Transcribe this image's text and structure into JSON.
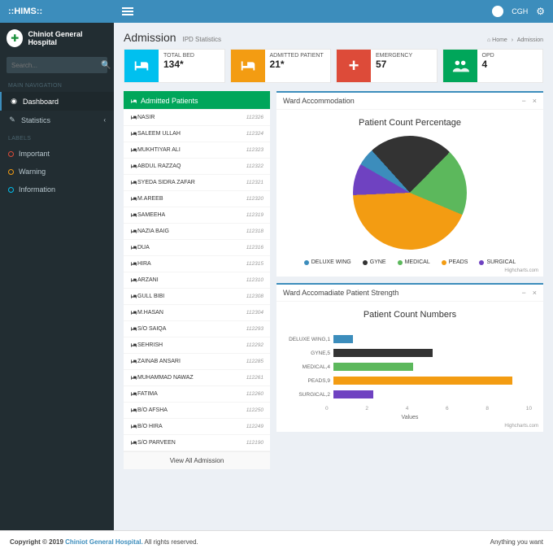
{
  "brand": "::HIMS::",
  "user_short": "CGH",
  "hospital_name": "Chiniot General Hospital",
  "search": {
    "placeholder": "Search..."
  },
  "nav": {
    "main_header": "MAIN NAVIGATION",
    "dashboard": "Dashboard",
    "statistics": "Statistics",
    "labels_header": "LABELS",
    "important": "Important",
    "warning": "Warning",
    "information": "Information"
  },
  "page": {
    "title": "Admission",
    "subtitle": "IPD Statistics",
    "breadcrumb_home": "Home",
    "breadcrumb_current": "Admission"
  },
  "stats": {
    "total_bed": {
      "label": "TOTAL BED",
      "value": "134*",
      "color": "#00c0ef"
    },
    "admitted": {
      "label": "ADMITTED PATIENT",
      "value": "21*",
      "color": "#f39c12"
    },
    "emergency": {
      "label": "EMERGENCY",
      "value": "57",
      "color": "#dd4b39"
    },
    "opd": {
      "label": "OPD",
      "value": "4",
      "color": "#00a65a"
    }
  },
  "patients": {
    "title": "Admitted Patients",
    "footer": "View All Admission",
    "list": [
      {
        "name": "NASIR",
        "id": "112326"
      },
      {
        "name": "SALEEM ULLAH",
        "id": "112324"
      },
      {
        "name": "MUKHTIYAR ALI",
        "id": "112323"
      },
      {
        "name": "ABDUL RAZZAQ",
        "id": "112322"
      },
      {
        "name": "SYEDA SIDRA ZAFAR",
        "id": "112321"
      },
      {
        "name": "M.AREEB",
        "id": "112320"
      },
      {
        "name": "SAMEEHA",
        "id": "112319"
      },
      {
        "name": "NAZIA BAIG",
        "id": "112318"
      },
      {
        "name": "DUA",
        "id": "112316"
      },
      {
        "name": "HIRA",
        "id": "112315"
      },
      {
        "name": "ARZANI",
        "id": "112310"
      },
      {
        "name": "GULL BIBI",
        "id": "112308"
      },
      {
        "name": "M.HASAN",
        "id": "112304"
      },
      {
        "name": "S/O SAIQA",
        "id": "112293"
      },
      {
        "name": "SEHRISH",
        "id": "112292"
      },
      {
        "name": "ZAINAB ANSARI",
        "id": "112285"
      },
      {
        "name": "MUHAMMAD NAWAZ",
        "id": "112261"
      },
      {
        "name": "FATIMA",
        "id": "112260"
      },
      {
        "name": "B/O AFSHA",
        "id": "112250"
      },
      {
        "name": "B/O HIRA",
        "id": "112249"
      },
      {
        "name": "S/O PARVEEN",
        "id": "112190"
      }
    ]
  },
  "pie_box": {
    "title": "Ward Accommodation"
  },
  "bar_box": {
    "title": "Ward Accomadiate Patient Strength"
  },
  "colors": {
    "deluxe": "#3c8dbc",
    "gyne": "#333333",
    "medical": "#5cb85c",
    "peads": "#f39c12",
    "surgical": "#6f42c1"
  },
  "chart_data": [
    {
      "type": "pie",
      "title": "Patient Count Percentage",
      "series": [
        {
          "name": "DELUXE WING",
          "value": 5,
          "color": "#3c8dbc"
        },
        {
          "name": "GYNE",
          "value": 24,
          "color": "#333333"
        },
        {
          "name": "MEDICAL",
          "value": 19,
          "color": "#5cb85c"
        },
        {
          "name": "PEADS",
          "value": 43,
          "color": "#f39c12"
        },
        {
          "name": "SURGICAL",
          "value": 9,
          "color": "#6f42c1"
        }
      ],
      "credits": "Highcharts.com"
    },
    {
      "type": "bar",
      "title": "Patient Count Numbers",
      "xlabel": "Values",
      "xlim": [
        0,
        10
      ],
      "ticks": [
        0,
        2,
        4,
        6,
        8,
        10
      ],
      "categories": [
        "DELUXE WING,1",
        "GYNE,5",
        "MEDICAL,4",
        "PEADS,9",
        "SURGICAL,2"
      ],
      "values": [
        1,
        5,
        4,
        9,
        2
      ],
      "colors": [
        "#3c8dbc",
        "#333333",
        "#5cb85c",
        "#f39c12",
        "#6f42c1"
      ],
      "credits": "Highcharts.com"
    }
  ],
  "footer": {
    "copyright_prefix": "Copyright © 2019 ",
    "company": "Chiniot General Hospital.",
    "rights": " All rights reserved.",
    "right_text": "Anything you want"
  }
}
